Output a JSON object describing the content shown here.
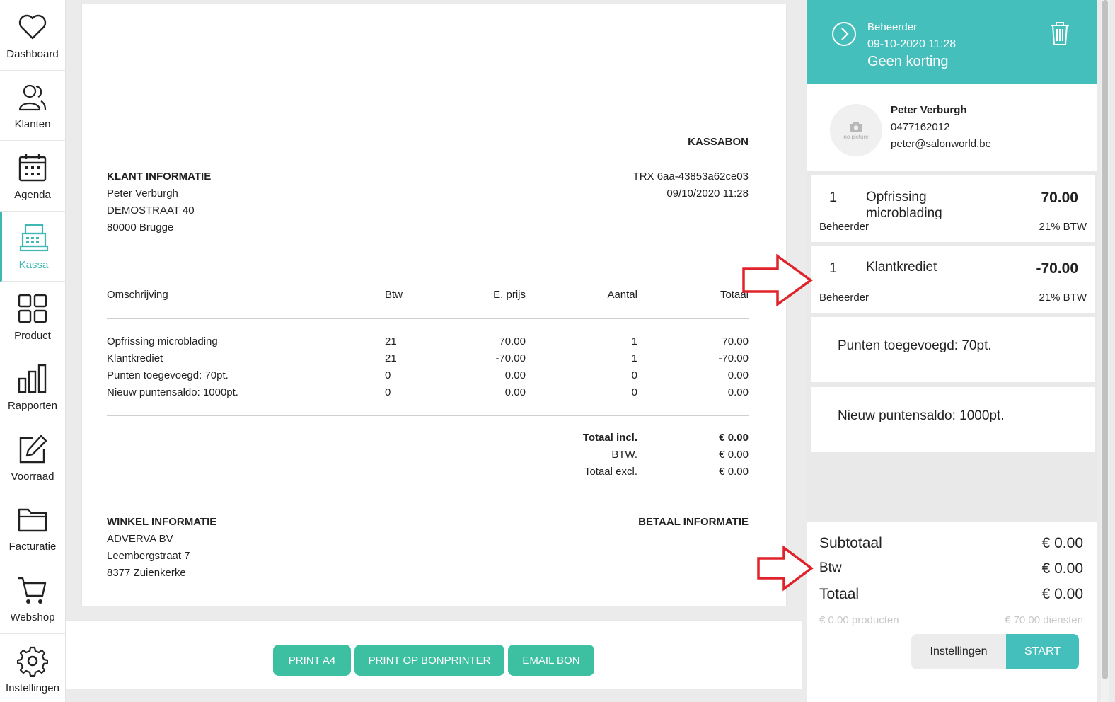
{
  "sidebar": {
    "items": [
      {
        "label": "Dashboard",
        "icon": "heart-icon"
      },
      {
        "label": "Klanten",
        "icon": "users-icon"
      },
      {
        "label": "Agenda",
        "icon": "calendar-icon"
      },
      {
        "label": "Kassa",
        "icon": "cash-register-icon",
        "active": true
      },
      {
        "label": "Product",
        "icon": "grid-icon"
      },
      {
        "label": "Rapporten",
        "icon": "bar-chart-icon"
      },
      {
        "label": "Voorraad",
        "icon": "edit-icon"
      },
      {
        "label": "Facturatie",
        "icon": "folder-icon"
      },
      {
        "label": "Webshop",
        "icon": "cart-icon"
      },
      {
        "label": "Instellingen",
        "icon": "gear-icon"
      }
    ]
  },
  "receipt": {
    "title": "KASSABON",
    "client_heading": "KLANT INFORMATIE",
    "client_name": "Peter Verburgh",
    "client_street": "DEMOSTRAAT 40",
    "client_city": "80000 Brugge",
    "trx": "TRX 6aa-43853a62ce03",
    "datetime": "09/10/2020 11:28",
    "columns": [
      "Omschrijving",
      "Btw",
      "E. prijs",
      "Aantal",
      "Totaal"
    ],
    "rows": [
      [
        "Opfrissing microblading",
        "21",
        "70.00",
        "1",
        "70.00"
      ],
      [
        "Klantkrediet",
        "21",
        "-70.00",
        "1",
        "-70.00"
      ],
      [
        "Punten toegevoegd: 70pt.",
        "0",
        "0.00",
        "0",
        "0.00"
      ],
      [
        "Nieuw puntensaldo: 1000pt.",
        "0",
        "0.00",
        "0",
        "0.00"
      ]
    ],
    "sum_labels": [
      "Totaal incl.",
      "BTW.",
      "Totaal excl."
    ],
    "sum_values": [
      "€ 0.00",
      "€ 0.00",
      "€ 0.00"
    ],
    "shop_heading": "WINKEL INFORMATIE",
    "shop_name": "ADVERVA BV",
    "shop_street": "Leembergstraat 7",
    "shop_city": "8377 Zuienkerke",
    "pay_heading": "BETAAL INFORMATIE"
  },
  "actions": {
    "print_a4": "PRINT A4",
    "print_bon": "PRINT OP BONPRINTER",
    "email_bon": "EMAIL BON"
  },
  "panel": {
    "user": "Beheerder",
    "datetime": "09-10-2020 11:28",
    "discount": "Geen korting",
    "customer": {
      "avatar_text": "no picture",
      "name": "Peter Verburgh",
      "phone": "0477162012",
      "email": "peter@salonworld.be"
    },
    "lines": [
      {
        "qty": "1",
        "name": "Opfrissing microblading",
        "price": "70.00",
        "staff": "Beheerder",
        "vat": "21% BTW"
      },
      {
        "qty": "1",
        "name": "Klantkrediet",
        "price": "-70.00",
        "staff": "Beheerder",
        "vat": "21% BTW"
      }
    ],
    "notes": [
      "Punten toegevoegd: 70pt.",
      "Nieuw puntensaldo: 1000pt."
    ],
    "subtotal_label": "Subtotaal",
    "subtotal_value": "€ 0.00",
    "btw_label": "Btw",
    "btw_value": "€ 0.00",
    "total_label": "Totaal",
    "total_value": "€ 0.00",
    "products_note": "€ 0.00 producten",
    "services_note": "€ 70.00 diensten",
    "settings_button": "Instellingen",
    "start_button": "START"
  },
  "colors": {
    "accent": "#45bfbc",
    "button_green": "#3dbfa2",
    "arrow_red": "#e0222a"
  }
}
